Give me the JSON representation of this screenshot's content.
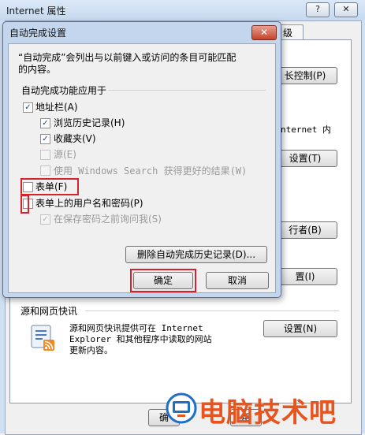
{
  "outer": {
    "title": "Internet 属性",
    "help_glyph": "?",
    "close_glyph": "✕",
    "tab_partial": "级",
    "btn_parental": "长控制(P)",
    "text_internet": "nternet 内",
    "btn_settings1": "设置(T)",
    "btn_publisher": "行者(B)",
    "btn_settings2": "置(I)",
    "feeds_group": "源和网页快讯",
    "feeds_desc_l1": "源和网页快讯提供可在 Internet",
    "feeds_desc_l2": "Explorer 和其他程序中读取的网站",
    "feeds_desc_l3": "更新内容。",
    "btn_feeds_settings": "设置(N)",
    "btn_ok_partial": "确",
    "btn_apply_partial": "用"
  },
  "dialog": {
    "title": "自动完成设置",
    "close_glyph": "✕",
    "desc_l1": "“自动完成”会列出与以前键入或访问的条目可能匹配",
    "desc_l2": "的内容。",
    "group_label": "自动完成功能应用于",
    "items": [
      {
        "label": "地址栏(A)",
        "checked": "✓"
      },
      {
        "label": "浏览历史记录(H)",
        "checked": "✓"
      },
      {
        "label": "收藏夹(V)",
        "checked": "✓"
      },
      {
        "label": "源(E)",
        "checked": ""
      },
      {
        "label": "使用 Windows Search 获得更好的结果(W)",
        "checked": ""
      },
      {
        "label": "表单(F)",
        "checked": ""
      },
      {
        "label": "表单上的用户名和密码(P)",
        "checked": ""
      },
      {
        "label": "在保存密码之前询问我(S)",
        "checked": "✓"
      }
    ],
    "btn_delete_history": "删除自动完成历史记录(D)...",
    "btn_ok": "确定",
    "btn_cancel": "取消"
  },
  "watermark": {
    "text": "电脑技术吧"
  },
  "colors": {
    "highlight": "#d6222a",
    "watermark": "#e8541e"
  }
}
